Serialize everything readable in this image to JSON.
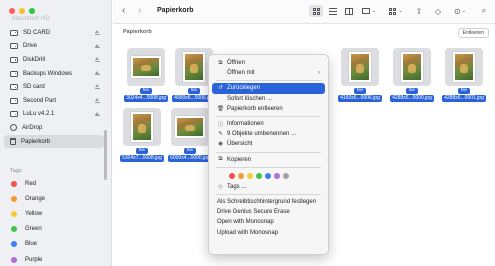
{
  "sidebar": {
    "top_faded": "Macintosh HD",
    "items": [
      {
        "label": "SD CARD",
        "icon": "drive-icon",
        "eject": true
      },
      {
        "label": "Drive",
        "icon": "drive-icon",
        "eject": true
      },
      {
        "label": "DiskDrill",
        "icon": "drive-icon",
        "eject": true
      },
      {
        "label": "Backups Windows",
        "icon": "drive-icon",
        "eject": true
      },
      {
        "label": "SD card",
        "icon": "drive-icon",
        "eject": true
      },
      {
        "label": "Second Part",
        "icon": "drive-icon",
        "eject": true
      },
      {
        "label": "LuLu v4.2.1",
        "icon": "drive-icon",
        "eject": true
      },
      {
        "label": "AirDrop",
        "icon": "airdrop-icon",
        "eject": false
      },
      {
        "label": "Papierkorb",
        "icon": "trash-icon",
        "eject": false,
        "active": true
      }
    ],
    "tags_heading": "Tags",
    "tags": [
      {
        "label": "Red",
        "color": "#f0524d"
      },
      {
        "label": "Orange",
        "color": "#f59a2f"
      },
      {
        "label": "Yellow",
        "color": "#f5cc2f"
      },
      {
        "label": "Green",
        "color": "#47c04c"
      },
      {
        "label": "Blue",
        "color": "#3a7ff5"
      },
      {
        "label": "Purple",
        "color": "#b06dd6"
      }
    ]
  },
  "toolbar": {
    "back": "‹",
    "forward": "›",
    "title": "Papierkorb"
  },
  "pathbar": {
    "label": "Papierkorb",
    "empty_button": "Entleeren"
  },
  "files": [
    {
      "badge": "file",
      "name": "3024x4...0008.jpg"
    },
    {
      "badge": "file",
      "name": "4000x6...0006.jpg"
    },
    {
      "badge": "file",
      "name": "4160x6...0006.jpg"
    },
    {
      "badge": "file",
      "name": "4288x6...0000.jpg"
    },
    {
      "badge": "file",
      "name": "4288x6...0001.jpg"
    },
    {
      "badge": "file",
      "name": "5304x7...0008.jpg"
    },
    {
      "badge": "file",
      "name": "6000x4...0000.jpg"
    }
  ],
  "context_menu": {
    "items": [
      {
        "label": "Öffnen",
        "icon": "open-icon",
        "group": 1
      },
      {
        "label": "Öffnen mit",
        "icon": "",
        "group": 1,
        "submenu": true
      },
      {
        "label": "Zurücklegen",
        "icon": "restore-icon",
        "group": 2,
        "highlighted": true
      },
      {
        "label": "Sofort löschen ...",
        "icon": "",
        "group": 2
      },
      {
        "label": "Papierkorb entleeren",
        "icon": "trash-icon",
        "group": 2
      },
      {
        "label": "Informationen",
        "icon": "info-icon",
        "group": 3
      },
      {
        "label": "9 Objekte umbenennen ...",
        "icon": "pencil-icon",
        "group": 3
      },
      {
        "label": "Übersicht",
        "icon": "eye-icon",
        "group": 3
      },
      {
        "label": "Kopieren",
        "icon": "copy-icon",
        "group": 4
      },
      {
        "label": "Tags ...",
        "icon": "tag-icon",
        "group": 5
      },
      {
        "label": "Als Schreibtischhintergrund festlegen",
        "icon": "",
        "group": 6
      },
      {
        "label": "Drive Genius Secure Erase",
        "icon": "",
        "group": 6
      },
      {
        "label": "Open with Monosnap",
        "icon": "",
        "group": 6
      },
      {
        "label": "Upload with Monosnap",
        "icon": "",
        "group": 6
      }
    ],
    "tag_colors": [
      "#f0524d",
      "#f59a2f",
      "#f5cc2f",
      "#47c04c",
      "#3a7ff5",
      "#b06dd6",
      "#a0a0a5"
    ]
  }
}
